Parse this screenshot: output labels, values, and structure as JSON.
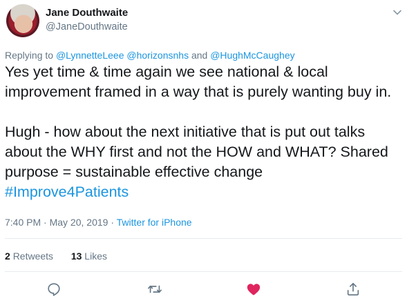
{
  "tweet": {
    "author_name": "Jane Douthwaite",
    "author_handle": "@JaneDouthwaite",
    "replying_prefix": "Replying to ",
    "reply_to_1": "@LynnetteLeee",
    "reply_to_2": "@horizonsnhs",
    "reply_and": " and ",
    "reply_to_3": "@HughMcCaughey",
    "paragraph_1": "Yes yet time & time again we see national & local improvement framed in a way that is purely wanting buy in.",
    "paragraph_2": "Hugh - how about the next initiative that is put out talks about the WHY first and not the HOW and WHAT? Shared purpose = sustainable effective change",
    "hashtag": "#Improve4Patients",
    "time": "7:40 PM",
    "date": "May 20, 2019",
    "separator": " · ",
    "source": "Twitter for iPhone",
    "retweet_count": "2",
    "retweet_label": "Retweets",
    "like_count": "13",
    "like_label": "Likes",
    "icons": [
      "chevron-down-icon",
      "reply-icon",
      "retweet-icon",
      "heart-icon",
      "share-icon"
    ],
    "colors": {
      "link": "#1b95e0",
      "like": "#e0245e",
      "muted": "#657786"
    }
  }
}
